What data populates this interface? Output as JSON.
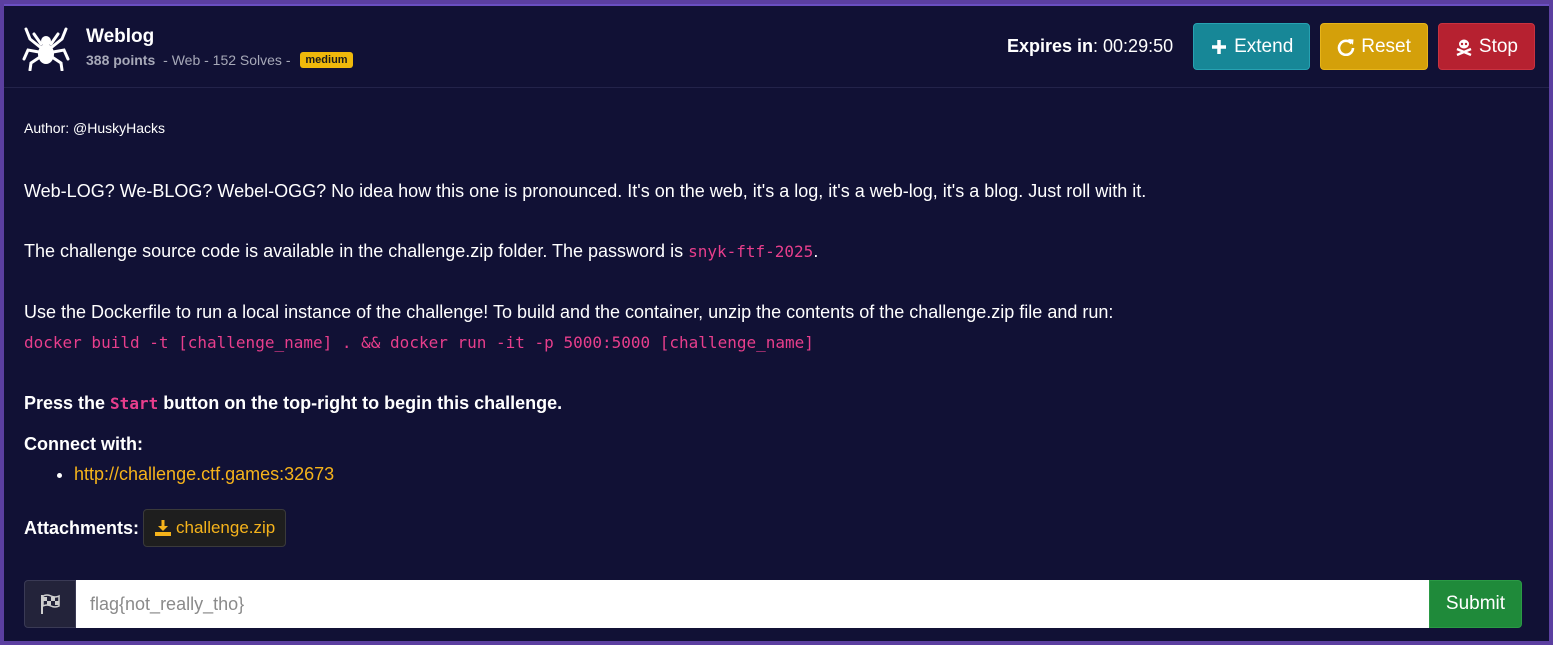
{
  "challenge": {
    "title": "Weblog",
    "points": "388 points",
    "category_text": " - Web - 152 Solves - ",
    "difficulty": "medium"
  },
  "timer": {
    "label": "Expires in",
    "value": ": 00:29:50"
  },
  "buttons": {
    "extend": "Extend",
    "reset": "Reset",
    "stop": "Stop"
  },
  "description": {
    "author": "Author: @HuskyHacks",
    "intro": "Web-LOG? We-BLOG? Webel-OGG? No idea how this one is pronounced. It's on the web, it's a log, it's a web-log, it's a blog. Just roll with it.",
    "source_prefix": "The challenge source code is available in the challenge.zip folder. The password is ",
    "password": "snyk-ftf-2025",
    "source_suffix": ".",
    "docker_text": "Use the Dockerfile to run a local instance of the challenge! To build and the container, unzip the contents of the challenge.zip file and run:",
    "docker_command": "docker build -t [challenge_name] . && docker run -it -p 5000:5000 [challenge_name]",
    "press_prefix": "Press the ",
    "press_code": "Start",
    "press_suffix": " button on the top-right to begin this challenge.",
    "connect_label": "Connect with:",
    "connect_url": "http://challenge.ctf.games:32673"
  },
  "attachments": {
    "label": "Attachments:",
    "file": "challenge.zip"
  },
  "flag_form": {
    "placeholder": "flag{not_really_tho}",
    "submit": "Submit"
  },
  "colors": {
    "background": "#111135",
    "extend": "#178797",
    "reset": "#d4a00a",
    "stop": "#b62130",
    "code": "#e83e8c",
    "link": "#f5b31b",
    "submit": "#1f8a3a"
  },
  "icons": {
    "logo": "spider-icon",
    "extend": "plus-icon",
    "reset": "refresh-icon",
    "stop": "skull-crossbones-icon",
    "attachment": "download-icon",
    "flag": "flag-checkered-icon"
  }
}
